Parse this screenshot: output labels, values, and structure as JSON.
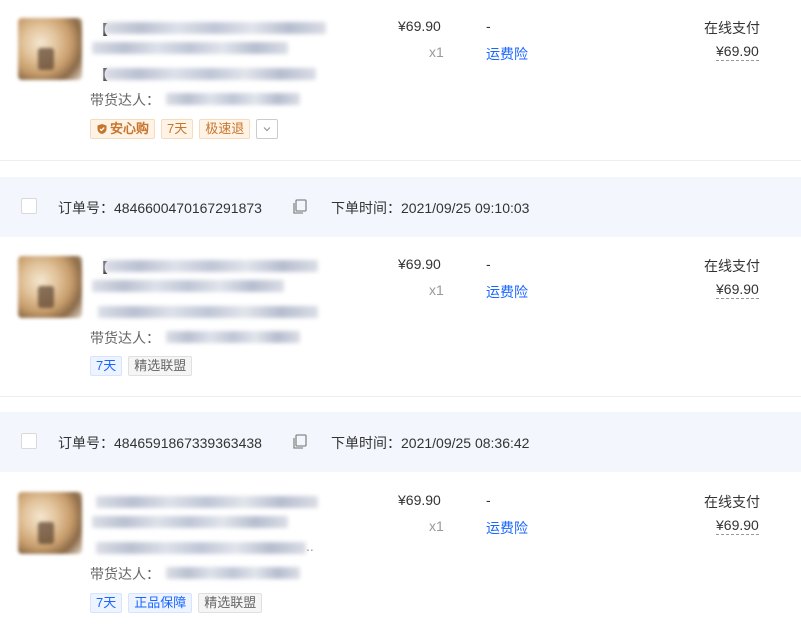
{
  "orders": [
    {
      "order_no_label": "订单号：",
      "order_no": "4846600470167291873",
      "time_label": "下单时间：",
      "time": "2021/09/25 09:10:03"
    },
    {
      "order_no_label": "订单号：",
      "order_no": "4846591867339363438",
      "time_label": "下单时间：",
      "time": "2021/09/25 08:36:42"
    }
  ],
  "items": [
    {
      "price": "¥69.90",
      "qty": "x1",
      "dash": "-",
      "freight": "运费险",
      "pay_method": "在线支付",
      "pay_amount": "¥69.90",
      "anchor_label": "带货达人：",
      "tags": [
        "安心购",
        "7天",
        "极速退"
      ]
    },
    {
      "price": "¥69.90",
      "qty": "x1",
      "dash": "-",
      "freight": "运费险",
      "pay_method": "在线支付",
      "pay_amount": "¥69.90",
      "anchor_label": "带货达人：",
      "tags": [
        "7天",
        "精选联盟"
      ]
    },
    {
      "price": "¥69.90",
      "qty": "x1",
      "dash": "-",
      "freight": "运费险",
      "pay_method": "在线支付",
      "pay_amount": "¥69.90",
      "anchor_label": "带货达人：",
      "tags": [
        "7天",
        "正品保障",
        "精选联盟"
      ]
    }
  ],
  "icons": {
    "copy": "copy-icon",
    "shield": "shield-icon",
    "chevron": "chevron-down-icon"
  },
  "colors": {
    "link_blue": "#1966ff",
    "header_bg": "#f3f7fd",
    "tag_orange": "#c7752d"
  }
}
